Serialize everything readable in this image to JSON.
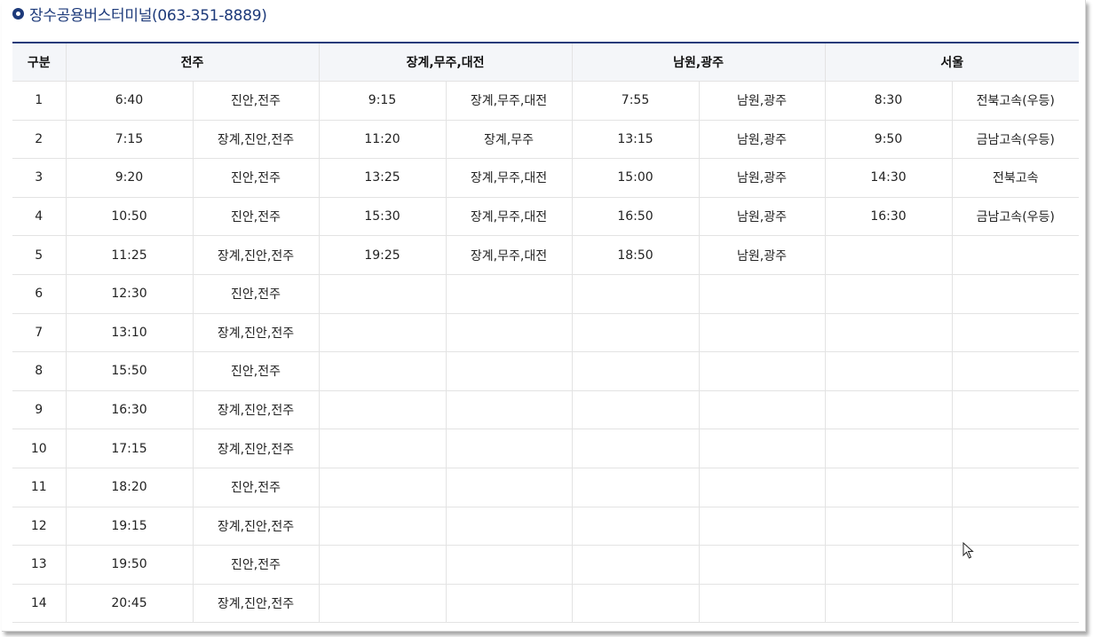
{
  "title": "장수공용버스터미널(063-351-8889)",
  "headers": {
    "gubun": "구분",
    "jeonju": "전주",
    "janggye": "장계,무주,대전",
    "namwon": "남원,광주",
    "seoul": "서울"
  },
  "rows": [
    {
      "no": "1",
      "jeonju_time": "6:40",
      "jeonju_route": "진안,전주",
      "jg_time": "9:15",
      "jg_route": "장계,무주,대전",
      "nw_time": "7:55",
      "nw_route": "남원,광주",
      "se_time": "8:30",
      "se_route": "전북고속(우등)"
    },
    {
      "no": "2",
      "jeonju_time": "7:15",
      "jeonju_route": "장계,진안,전주",
      "jg_time": "11:20",
      "jg_route": "장계,무주",
      "nw_time": "13:15",
      "nw_route": "남원,광주",
      "se_time": "9:50",
      "se_route": "금남고속(우등)"
    },
    {
      "no": "3",
      "jeonju_time": "9:20",
      "jeonju_route": "진안,전주",
      "jg_time": "13:25",
      "jg_route": "장계,무주,대전",
      "nw_time": "15:00",
      "nw_route": "남원,광주",
      "se_time": "14:30",
      "se_route": "전북고속"
    },
    {
      "no": "4",
      "jeonju_time": "10:50",
      "jeonju_route": "진안,전주",
      "jg_time": "15:30",
      "jg_route": "장계,무주,대전",
      "nw_time": "16:50",
      "nw_route": "남원,광주",
      "se_time": "16:30",
      "se_route": "금남고속(우등)"
    },
    {
      "no": "5",
      "jeonju_time": "11:25",
      "jeonju_route": "장계,진안,전주",
      "jg_time": "19:25",
      "jg_route": "장계,무주,대전",
      "nw_time": "18:50",
      "nw_route": "남원,광주",
      "se_time": "",
      "se_route": ""
    },
    {
      "no": "6",
      "jeonju_time": "12:30",
      "jeonju_route": "진안,전주",
      "jg_time": "",
      "jg_route": "",
      "nw_time": "",
      "nw_route": "",
      "se_time": "",
      "se_route": ""
    },
    {
      "no": "7",
      "jeonju_time": "13:10",
      "jeonju_route": "장계,진안,전주",
      "jg_time": "",
      "jg_route": "",
      "nw_time": "",
      "nw_route": "",
      "se_time": "",
      "se_route": ""
    },
    {
      "no": "8",
      "jeonju_time": "15:50",
      "jeonju_route": "진안,전주",
      "jg_time": "",
      "jg_route": "",
      "nw_time": "",
      "nw_route": "",
      "se_time": "",
      "se_route": ""
    },
    {
      "no": "9",
      "jeonju_time": "16:30",
      "jeonju_route": "장계,진안,전주",
      "jg_time": "",
      "jg_route": "",
      "nw_time": "",
      "nw_route": "",
      "se_time": "",
      "se_route": ""
    },
    {
      "no": "10",
      "jeonju_time": "17:15",
      "jeonju_route": "장계,진안,전주",
      "jg_time": "",
      "jg_route": "",
      "nw_time": "",
      "nw_route": "",
      "se_time": "",
      "se_route": ""
    },
    {
      "no": "11",
      "jeonju_time": "18:20",
      "jeonju_route": "진안,전주",
      "jg_time": "",
      "jg_route": "",
      "nw_time": "",
      "nw_route": "",
      "se_time": "",
      "se_route": ""
    },
    {
      "no": "12",
      "jeonju_time": "19:15",
      "jeonju_route": "장계,진안,전주",
      "jg_time": "",
      "jg_route": "",
      "nw_time": "",
      "nw_route": "",
      "se_time": "",
      "se_route": ""
    },
    {
      "no": "13",
      "jeonju_time": "19:50",
      "jeonju_route": "진안,전주",
      "jg_time": "",
      "jg_route": "",
      "nw_time": "",
      "nw_route": "",
      "se_time": "",
      "se_route": ""
    },
    {
      "no": "14",
      "jeonju_time": "20:45",
      "jeonju_route": "장계,진안,전주",
      "jg_time": "",
      "jg_route": "",
      "nw_time": "",
      "nw_route": "",
      "se_time": "",
      "se_route": ""
    }
  ],
  "icons": {
    "title_bullet": "circle-bullet-icon",
    "cursor": "mouse-pointer-icon"
  },
  "colors": {
    "accent": "#1d3a7a",
    "header_bg": "#f4f6f9",
    "grid": "#e3e3e3"
  }
}
